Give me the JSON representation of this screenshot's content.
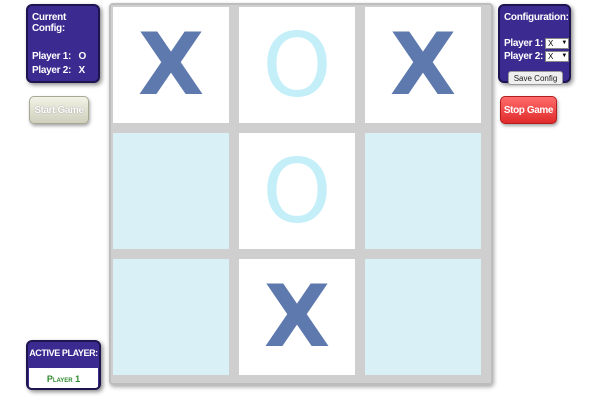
{
  "current_config": {
    "title": "Current Config:",
    "player1_label": "Player 1:",
    "player1_value": "O",
    "player2_label": "Player 2:",
    "player2_value": "X"
  },
  "configuration": {
    "title": "Configuration:",
    "player1_label": "Player 1:",
    "player1_selected": "X",
    "player2_label": "Player 2:",
    "player2_selected": "X",
    "save_label": "Save Config"
  },
  "controls": {
    "start_label": "Start Game",
    "stop_label": "Stop Game"
  },
  "board": {
    "cells": [
      "X",
      "O",
      "X",
      "",
      "O",
      "",
      "",
      "X",
      ""
    ]
  },
  "active_player": {
    "title": "ACTIVE PLAYER:",
    "value": "Player 1"
  },
  "colors": {
    "panel": "#3b2a8f",
    "x_mark": "#5e79ad",
    "o_mark": "#c4eff9",
    "empty_cell": "#d9f1f6",
    "stop_button": "#e83636",
    "active_player_text": "#2e8b2e"
  }
}
